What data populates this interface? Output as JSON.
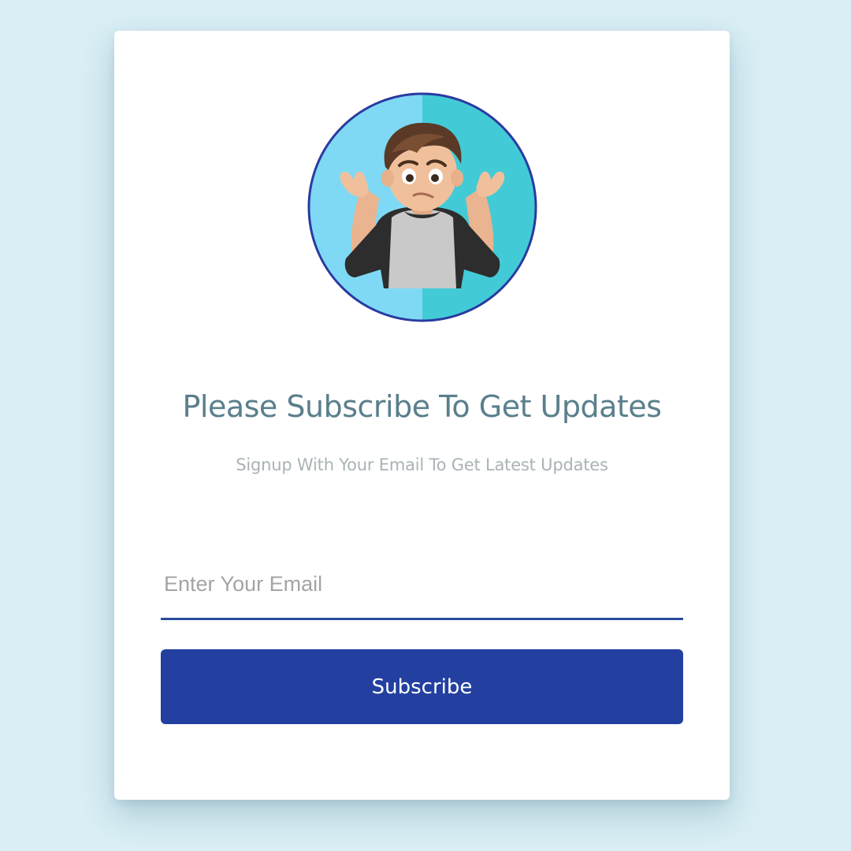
{
  "card": {
    "avatar_icon": "shrugging-person-emoji-avatar",
    "title": "Please Subscribe To Get Updates",
    "subtitle": "Signup With Your Email To Get Latest Updates"
  },
  "form": {
    "email_placeholder": "Enter Your Email",
    "email_value": "",
    "button_label": "Subscribe"
  },
  "colors": {
    "background": "#d9eef5",
    "title": "#5a7f8c",
    "subtitle": "#a9b3b6",
    "accent": "#2340a0",
    "avatar_left": "#7fd9f5",
    "avatar_right": "#42cbd6"
  }
}
